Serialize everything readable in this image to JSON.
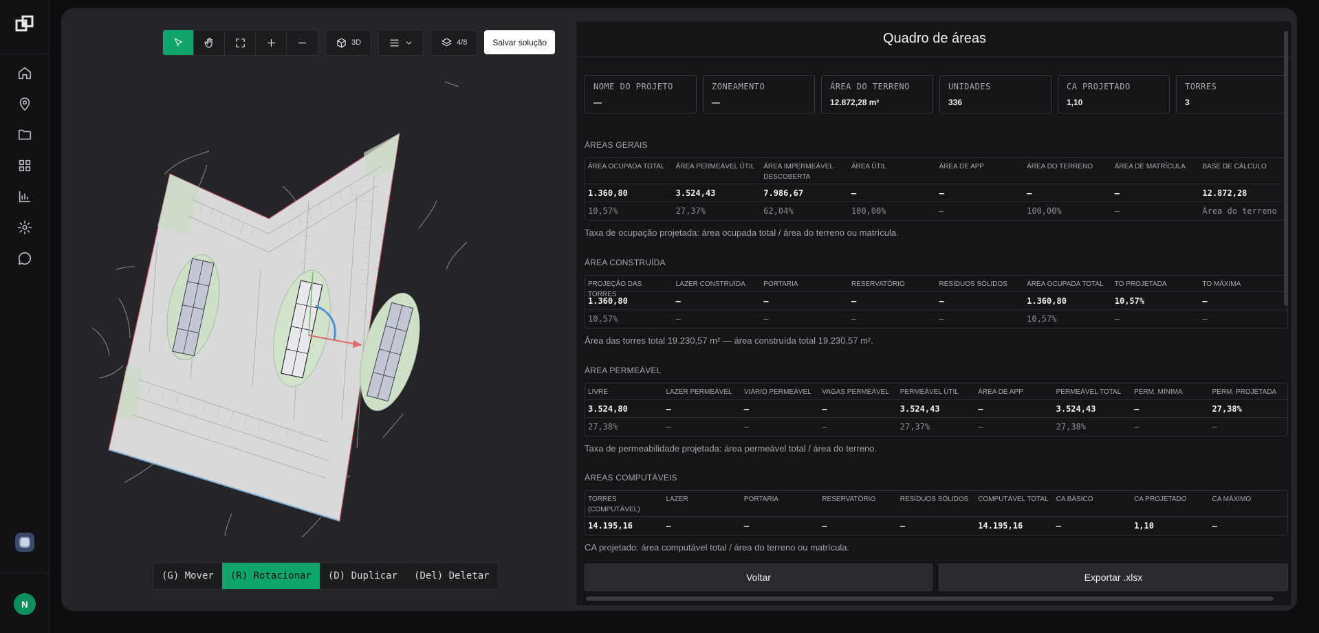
{
  "toolbar": {
    "view_3d_label": "3D",
    "layers_label": "4/8",
    "save_label": "Salvar solução"
  },
  "actions": [
    {
      "label": "(G) Mover",
      "active": false
    },
    {
      "label": "(R) Rotacionar",
      "active": true
    },
    {
      "label": "(D) Duplicar",
      "active": false
    },
    {
      "label": "(Del) Deletar",
      "active": false
    }
  ],
  "user": {
    "initial": "N"
  },
  "colors": {
    "accent": "#0fa56b",
    "avatar": "#0f8f5e"
  },
  "panel": {
    "title": "Quadro de áreas",
    "summary": [
      {
        "label": "NOME DO PROJETO",
        "value": "—"
      },
      {
        "label": "ZONEAMENTO",
        "value": "—"
      },
      {
        "label": "ÁREA DO TERRENO",
        "value": "12.872,28 m²"
      },
      {
        "label": "UNIDADES",
        "value": "336"
      },
      {
        "label": "CA PROJETADO",
        "value": "1,10"
      },
      {
        "label": "TORRES",
        "value": "3"
      }
    ],
    "areas_gerais": {
      "title": "ÁREAS GERAIS",
      "headers": [
        "ÁREA OCUPADA TOTAL",
        "ÁREA PERMEÁVEL ÚTIL",
        "ÁREA IMPERMEÁVEL DESCOBERTA",
        "ÁREA ÚTIL",
        "ÁREA DE APP",
        "ÁREA DO TERRENO",
        "ÁREA DE MATRÍCULA",
        "BASE DE CÁLCULO"
      ],
      "values": [
        "1.360,80",
        "3.524,43",
        "7.986,67",
        "—",
        "—",
        "—",
        "—",
        "12.872,28"
      ],
      "percents": [
        "10,57%",
        "27,37%",
        "62,04%",
        "100,00%",
        "—",
        "100,00%",
        "—",
        "Área do terreno"
      ],
      "note": "Taxa de ocupação projetada: área ocupada total / área do terreno ou matrícula."
    },
    "area_construida": {
      "title": "ÁREA CONSTRUÍDA",
      "headers": [
        "PROJEÇÃO DAS TORRES",
        "LAZER CONSTRUÍDA",
        "PORTARIA",
        "RESERVATÓRIO",
        "RESÍDUOS SÓLIDOS",
        "ÁREA OCUPADA TOTAL",
        "TO PROJETADA",
        "TO MÁXIMA"
      ],
      "values": [
        "1.360,80",
        "—",
        "—",
        "—",
        "—",
        "1.360,80",
        "10,57%",
        "—"
      ],
      "percents": [
        "10,57%",
        "—",
        "—",
        "—",
        "—",
        "10,57%",
        "—",
        "—"
      ],
      "note": "Área das torres total 19.230,57 m² — área construída total 19.230,57 m²."
    },
    "area_permeavel": {
      "title": "ÁREA PERMEÁVEL",
      "headers": [
        "LIVRE",
        "LAZER PERMEÁVEL",
        "VIÁRIO PERMEÁVEL",
        "VAGAS PERMEÁVEL",
        "PERMEÁVEL ÚTIL",
        "ÁREA DE APP",
        "PERMEÁVEL TOTAL",
        "PERM. MÍNIMA",
        "PERM. PROJETADA"
      ],
      "values": [
        "3.524,80",
        "—",
        "—",
        "—",
        "3.524,43",
        "—",
        "3.524,43",
        "—",
        "27,38%"
      ],
      "percents": [
        "27,38%",
        "—",
        "—",
        "—",
        "27,37%",
        "—",
        "27,38%",
        "—",
        "—"
      ],
      "note": "Taxa de permeabilidade projetada: área permeável total / área do terreno."
    },
    "areas_computaveis": {
      "title": "ÁREAS COMPUTÁVEIS",
      "headers": [
        "TORRES (COMPUTÁVEL)",
        "LAZER",
        "PORTARIA",
        "RESERVATÓRIO",
        "RESÍDUOS SÓLIDOS",
        "COMPUTÁVEL TOTAL",
        "CA BÁSICO",
        "CA PROJETADO",
        "CA MÁXIMO"
      ],
      "values": [
        "14.195,16",
        "—",
        "—",
        "—",
        "—",
        "14.195,16",
        "—",
        "1,10",
        "—"
      ],
      "note": "CA projetado: área computável total / área do terreno ou matrícula."
    },
    "back_label": "Voltar",
    "export_label": "Exportar .xlsx"
  }
}
